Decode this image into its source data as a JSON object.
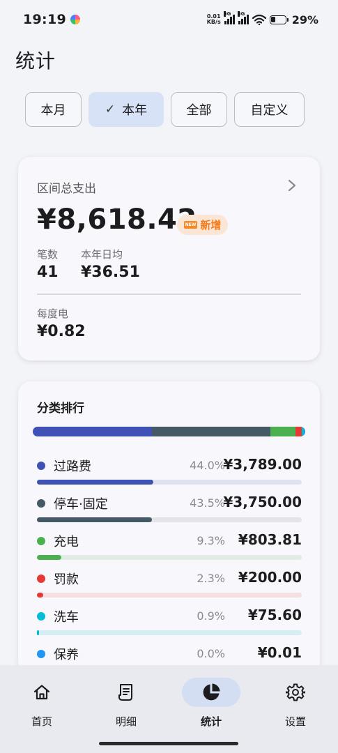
{
  "status": {
    "time": "19:19",
    "netspeed_value": "0.01",
    "netspeed_unit": "KB/s",
    "sig1_label": "5G",
    "sig2_label": "5G",
    "battery": "29%"
  },
  "page_title": "统计",
  "filters": [
    {
      "label": "本月",
      "active": false
    },
    {
      "label": "本年",
      "active": true
    },
    {
      "label": "全部",
      "active": false
    },
    {
      "label": "自定义",
      "active": false
    }
  ],
  "summary": {
    "label": "区间总支出",
    "amount": "¥8,618.42",
    "badge_tag": "NEW",
    "badge_text": "新增",
    "count_label": "笔数",
    "count_value": "41",
    "daily_label": "本年日均",
    "daily_value": "¥36.51",
    "per_kwh_label": "每度电",
    "per_kwh_value": "¥0.82"
  },
  "ranking": {
    "title": "分类排行",
    "categories": [
      {
        "name": "过路费",
        "percent": "44.0%",
        "amount": "¥3,789.00",
        "share": 0.44,
        "color": "#3f51b5",
        "track": "#dfe3f0"
      },
      {
        "name": "停车·固定",
        "percent": "43.5%",
        "amount": "¥3,750.00",
        "share": 0.435,
        "color": "#455a64",
        "track": "#e2e4e8"
      },
      {
        "name": "充电",
        "percent": "9.3%",
        "amount": "¥803.81",
        "share": 0.093,
        "color": "#4caf50",
        "track": "#e0ece4"
      },
      {
        "name": "罚款",
        "percent": "2.3%",
        "amount": "¥200.00",
        "share": 0.023,
        "color": "#e53935",
        "track": "#f4e0e3"
      },
      {
        "name": "洗车",
        "percent": "0.9%",
        "amount": "¥75.60",
        "share": 0.009,
        "color": "#00bcd4",
        "track": "#d6eef3"
      },
      {
        "name": "保养",
        "percent": "0.0%",
        "amount": "¥0.01",
        "share": 0.0,
        "color": "#2196f3",
        "track": "#dbe8f5"
      }
    ]
  },
  "nav": [
    {
      "label": "首页",
      "icon": "home-icon"
    },
    {
      "label": "明细",
      "icon": "receipt-icon"
    },
    {
      "label": "统计",
      "icon": "pie-chart-icon",
      "active": true
    },
    {
      "label": "设置",
      "icon": "gear-icon"
    }
  ]
}
